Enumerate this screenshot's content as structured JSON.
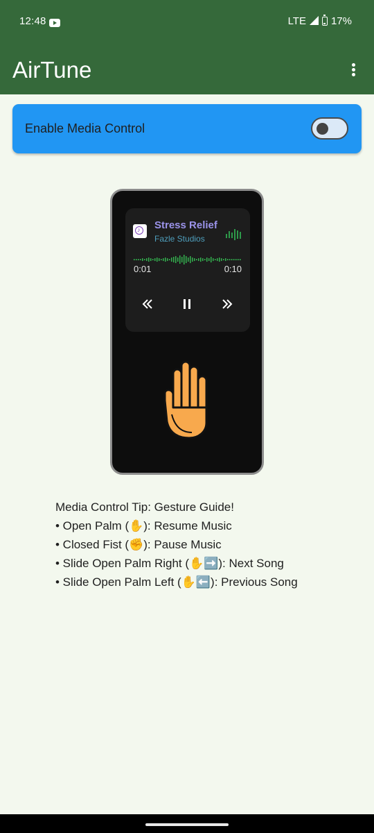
{
  "status_bar": {
    "time": "12:48",
    "network": "LTE",
    "battery": "17%"
  },
  "app_bar": {
    "title": "AirTune"
  },
  "media_control": {
    "label": "Enable Media Control",
    "enabled": false
  },
  "player": {
    "song_title": "Stress Relief",
    "artist": "Fazle Studios",
    "current_time": "0:01",
    "total_time": "0:10"
  },
  "tips": {
    "heading": "Media Control Tip: Gesture Guide!",
    "items": [
      "• Open Palm (✋): Resume Music",
      "• Closed Fist (✊): Pause Music",
      "• Slide Open Palm Right (✋➡️): Next Song",
      "• Slide Open Palm Left (✋⬅️): Previous Song"
    ]
  },
  "colors": {
    "app_bar": "#35693a",
    "card": "#2196f3",
    "background": "#f3f8ee"
  }
}
